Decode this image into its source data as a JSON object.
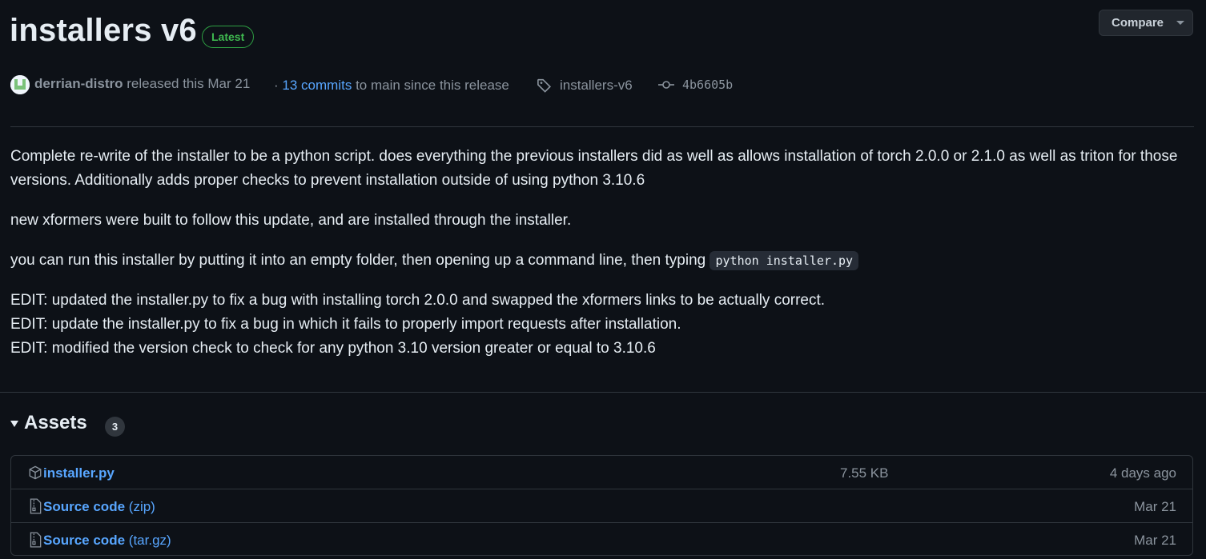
{
  "release": {
    "title": "installers v6",
    "badge": "Latest",
    "compare_label": "Compare"
  },
  "meta": {
    "author": "derrian-distro",
    "released_text": "released this Mar 21",
    "commits_prefix": "·",
    "commits_link": "13 commits",
    "commits_suffix": "to main since this release",
    "tag": "installers-v6",
    "commit_sha": "4b6605b"
  },
  "body": {
    "p1": "Complete re-write of the installer to be a python script. does everything the previous installers did as well as allows installation of torch 2.0.0 or 2.1.0 as well as triton for those versions. Additionally adds proper checks to prevent installation outside of using python 3.10.6",
    "p2": "new xformers were built to follow this update, and are installed through the installer.",
    "p3_text": "you can run this installer by putting it into an empty folder, then opening up a command line, then typing",
    "p3_code": "python installer.py",
    "edit1": "EDIT: updated the installer.py to fix a bug with installing torch 2.0.0 and swapped the xformers links to be actually correct.",
    "edit2": "EDIT: update the installer.py to fix a bug in which it fails to properly import requests after installation.",
    "edit3": "EDIT: modified the version check to check for any python 3.10 version greater or equal to 3.10.6"
  },
  "assets": {
    "heading": "Assets",
    "count": "3",
    "items": [
      {
        "name": "installer.py",
        "suffix": "",
        "size": "7.55 KB",
        "date": "4 days ago",
        "icon": "package-icon"
      },
      {
        "name": "Source code",
        "suffix": "(zip)",
        "size": "",
        "date": "Mar 21",
        "icon": "file-zip-icon"
      },
      {
        "name": "Source code",
        "suffix": "(tar.gz)",
        "size": "",
        "date": "Mar 21",
        "icon": "file-zip-icon"
      }
    ]
  },
  "colors": {
    "background": "#0d1117",
    "link": "#58a6ff",
    "badge_green": "#3fb950",
    "muted": "#8b949e"
  }
}
